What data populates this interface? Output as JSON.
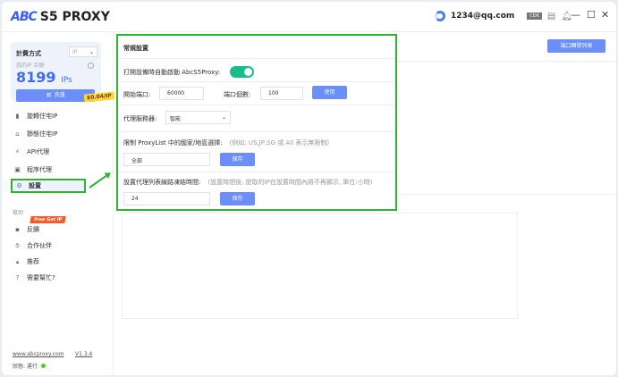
{
  "header": {
    "logo_mark": "ABC",
    "logo_text": "S5 PROXY",
    "email": "1234@qq.com",
    "cdk": "CDK"
  },
  "sidebar": {
    "billing_label": "計費方式",
    "billing_select": "IP",
    "remaining_label": "我的IP 余額",
    "ip_count": "8199",
    "ip_unit": "IPs",
    "recharge": "充值",
    "price_badge": "$0.04/IP",
    "items": [
      {
        "label": "旋轉住宅IP"
      },
      {
        "label": "靜態住宅IP"
      },
      {
        "label": "API代理"
      },
      {
        "label": "程序代理"
      },
      {
        "label": "設置"
      }
    ],
    "help_title": "幫助",
    "free_badge": "Free Get IP",
    "help_items": [
      {
        "label": "反饋"
      },
      {
        "label": "合作伙伴"
      },
      {
        "label": "推荐"
      },
      {
        "label": "需要幫忙?"
      }
    ],
    "website": "www.abcproxy.com",
    "version": "V1.3.4",
    "status_label": "狀態: 運行"
  },
  "main": {
    "port_forward_button": "端口轉發列表",
    "settings": {
      "title": "常規設置",
      "autostart_label": "打開設備時自動啟動 AbcS5Proxy:",
      "autostart_on": true,
      "start_port_label": "開始端口:",
      "start_port": "60000",
      "port_count_label": "端口個數:",
      "port_count": "100",
      "apply_button": "使用",
      "proxy_server_label": "代理服務器:",
      "proxy_server": "智能",
      "country_label": "限制 ProxyList 中的國家/地區選擇:",
      "country_hint": "(例如: US,JP,SG 或 All 表示無限制)",
      "country_value": "全部",
      "save_button": "保存",
      "freeze_label": "設置代理列表線路凍結時間:",
      "freeze_hint": "(設置時間後, 提取的IP在設置時間內將不再顯示, 單位:小時)",
      "freeze_value": "24",
      "save_button2": "保存"
    }
  }
}
